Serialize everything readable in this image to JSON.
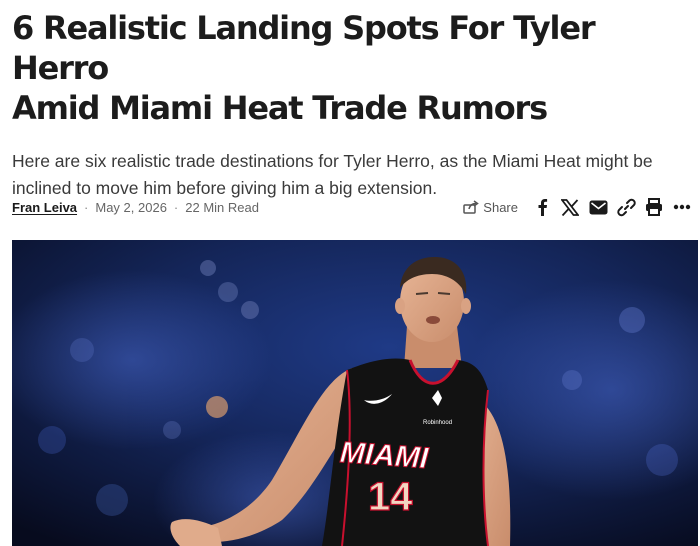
{
  "article": {
    "headline_line1": "6 Realistic Landing Spots For Tyler Herro",
    "headline_line2": "Amid Miami Heat Trade Rumors",
    "dek_line1": "Here are six realistic trade destinations for Tyler Herro, as the Miami Heat might be",
    "dek_line2": "inclined to move him before giving him a big extension.",
    "author": "Fran Leiva",
    "separator": "·",
    "date": "May 2, 2026",
    "read_time": "22 Min Read"
  },
  "share_bar": {
    "share_label": "Share",
    "icons": [
      "share-icon",
      "facebook-icon",
      "x-icon",
      "email-icon",
      "link-icon",
      "print-icon",
      "more-icon"
    ]
  },
  "hero_image": {
    "jersey_team": "MIAMI",
    "jersey_number": "14",
    "sponsor": "Robinhood",
    "colors": {
      "jersey": "#121212",
      "trim": "#c8102e",
      "background": "#0b1230"
    }
  }
}
